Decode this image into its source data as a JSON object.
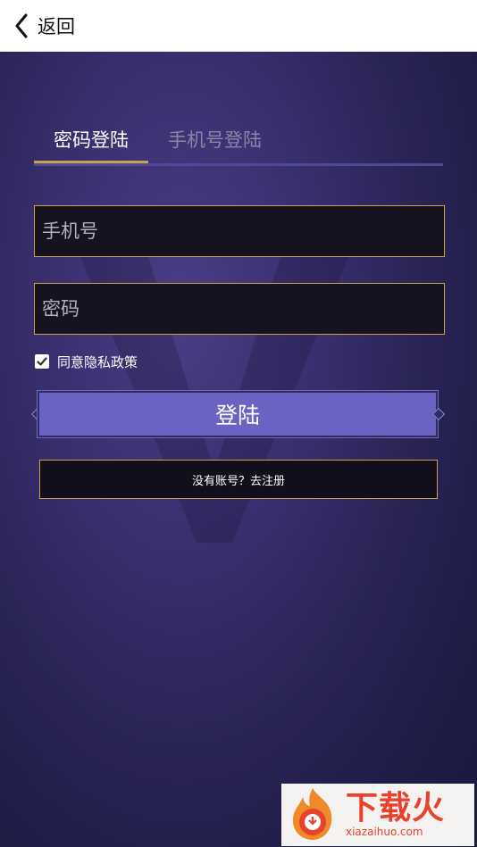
{
  "header": {
    "back_label": "返回"
  },
  "tabs": [
    {
      "label": "密码登陆",
      "active": true
    },
    {
      "label": "手机号登陆",
      "active": false
    }
  ],
  "form": {
    "phone_placeholder": "手机号",
    "password_placeholder": "密码",
    "agree_label": "同意隐私政策",
    "agree_checked": true,
    "login_label": "登陆",
    "register_label": "没有账号？去注册"
  },
  "watermark": {
    "title": "下载火",
    "url": "xiazaihuo.com"
  },
  "colors": {
    "accent_gold": "#c9a24e",
    "button_purple": "#6a63c2",
    "bg_purple": "#2b2558"
  }
}
